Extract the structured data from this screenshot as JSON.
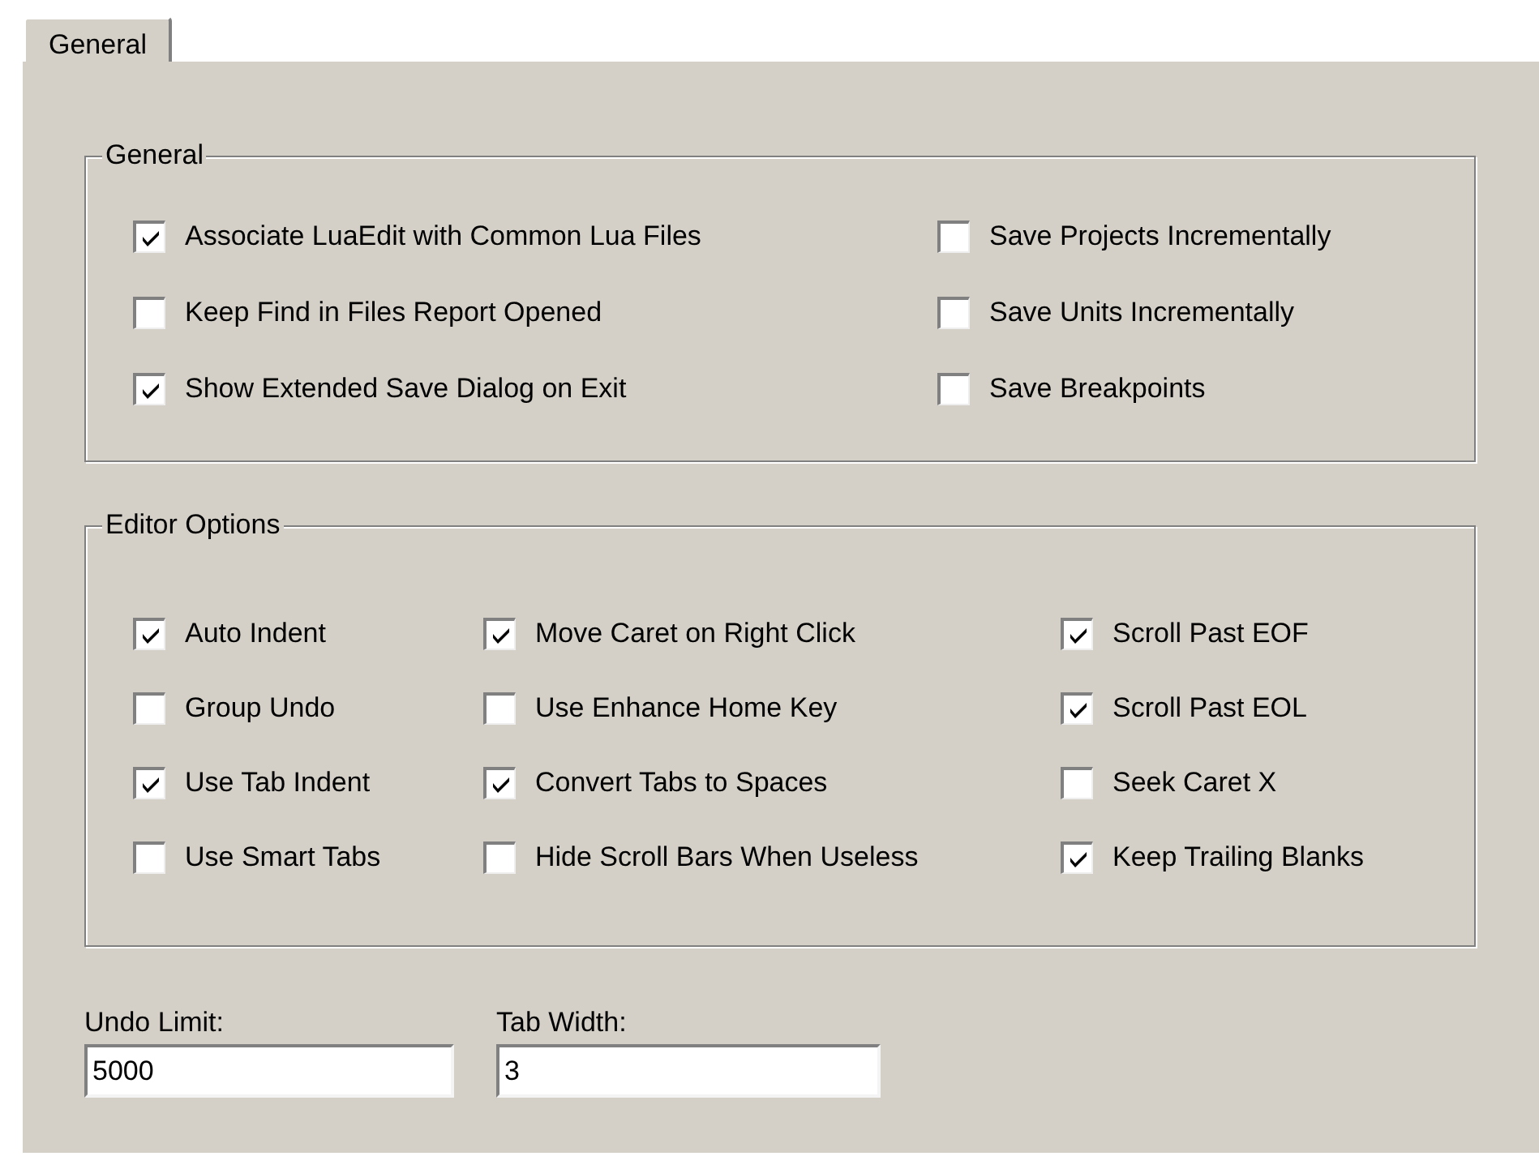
{
  "tabs": [
    {
      "label": "General",
      "selected": true
    }
  ],
  "groups": [
    {
      "title": "General",
      "columns": [
        [
          {
            "label": "Associate LuaEdit with Common Lua Files",
            "checked": true
          },
          {
            "label": "Keep Find in Files Report Opened",
            "checked": false
          },
          {
            "label": "Show Extended Save Dialog on Exit",
            "checked": true
          }
        ],
        [
          {
            "label": "Save Projects Incrementally",
            "checked": false
          },
          {
            "label": "Save Units Incrementally",
            "checked": false
          },
          {
            "label": "Save Breakpoints",
            "checked": false
          }
        ]
      ]
    },
    {
      "title": "Editor Options",
      "columns": [
        [
          {
            "label": "Auto Indent",
            "checked": true
          },
          {
            "label": "Group Undo",
            "checked": false
          },
          {
            "label": "Use Tab Indent",
            "checked": true
          },
          {
            "label": "Use Smart Tabs",
            "checked": false
          }
        ],
        [
          {
            "label": "Move Caret on Right Click",
            "checked": true
          },
          {
            "label": "Use Enhance Home Key",
            "checked": false
          },
          {
            "label": "Convert Tabs to Spaces",
            "checked": true
          },
          {
            "label": "Hide Scroll Bars When Useless",
            "checked": false
          }
        ],
        [
          {
            "label": "Scroll Past EOF",
            "checked": true
          },
          {
            "label": "Scroll Past EOL",
            "checked": true
          },
          {
            "label": "Seek Caret X",
            "checked": false
          },
          {
            "label": "Keep Trailing Blanks",
            "checked": true
          }
        ]
      ]
    }
  ],
  "fields": [
    {
      "label": "Undo Limit:",
      "value": "5000"
    },
    {
      "label": "Tab Width:",
      "value": "3"
    }
  ]
}
